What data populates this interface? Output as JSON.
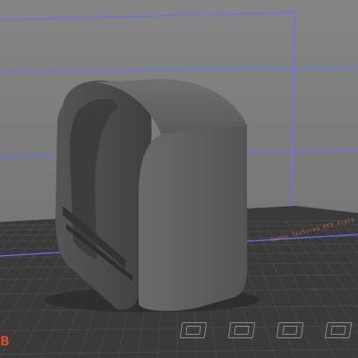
{
  "viewport": {
    "background_color": "#7a7a7a",
    "bed_color": "#3a3a3a",
    "grid_line_color": "#4a4a4a",
    "build_volume_edge_color": "#6f6cff",
    "model_color": "#5e5e60",
    "bed_accent_color": "#c8663a"
  },
  "bed": {
    "brand_label": "Bambu Textured PEI Plate",
    "corner_mark": "B",
    "icons": [
      "arrange-icon",
      "orient-icon",
      "plate-icon",
      "lock-icon"
    ]
  }
}
